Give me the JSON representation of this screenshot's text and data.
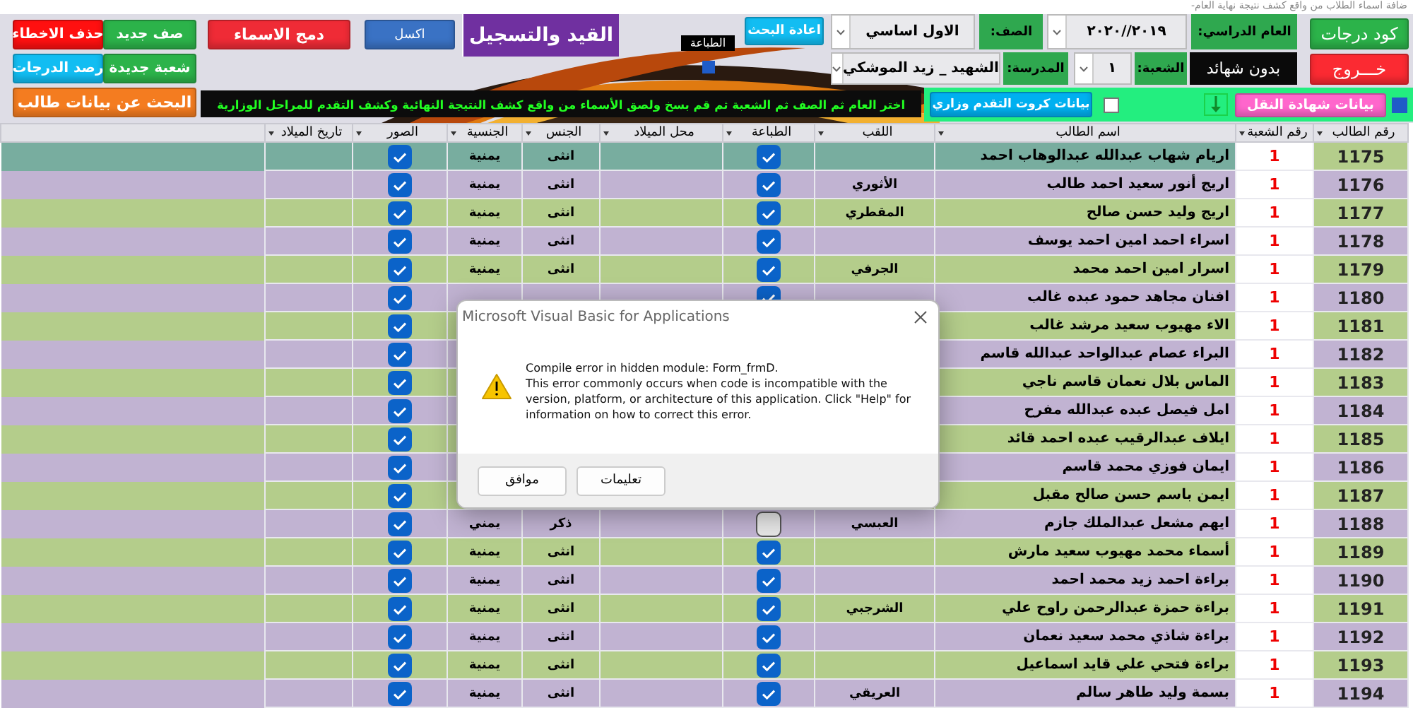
{
  "hint_text": "ضافة اسماء الطلاب من واقع كشف نتيجة نهاية العام-",
  "left_buttons": [
    {
      "label": "صف جديد",
      "color": "#2cb34a"
    },
    {
      "label": "حذف الاخطاء",
      "color": "#ff1010"
    },
    {
      "label": "شعبة جديدة",
      "color": "#2cb34a"
    },
    {
      "label": "رصد الدرجات",
      "color": "#12bdf2"
    },
    {
      "label": "البحث عن بيانات طالب",
      "color": "#f47c20"
    }
  ],
  "toolbar_buttons": [
    {
      "label": "اكسل",
      "color": "#3a72c4"
    },
    {
      "label": "دمج الاسماء",
      "color": "#ef2b36"
    }
  ],
  "title": "القيد والتسجيل",
  "print_toggle": {
    "label": "الطباعة",
    "checked": true
  },
  "reset_button": "اعادة البحث",
  "filters_top": [
    {
      "label": "العام الدراسي:",
      "value": "٢٠١٩//٢٠٢٠"
    },
    {
      "label": "الصف:",
      "value": "الاول اساسي"
    }
  ],
  "no_certificates": "بدون شهائد",
  "filters_bottom": [
    {
      "label": "الشعبة:",
      "value": "١"
    },
    {
      "label": "المدرسة:",
      "value": "الشهيد _ زيد الموشكي"
    }
  ],
  "right_buttons": [
    {
      "label": "كود درجات",
      "color": "#2cb34a"
    },
    {
      "label": "خـــروج",
      "color": "#fb2a32"
    }
  ],
  "notice": "اختر العام ثم الصف ثم الشعبة ثم قم بسخ ولصق الأسماء من واقع كشف النتيجة النهائية وكشف التقدم للمراحل الوزارية",
  "transfer_certificate": {
    "label": "بيانات شهادة النقل",
    "checked": true
  },
  "progress_cards": {
    "label": "بيانات كروت التقدم وزاري",
    "checked": false
  },
  "table": {
    "columns": [
      "رقم الطالب",
      "رقم الشعبة",
      "اسم الطالب",
      "اللقب",
      "الطباعة",
      "محل الميلاد",
      "الجنس",
      "الجنسية",
      "الصور",
      "تاريخ الميلاد"
    ],
    "rows": [
      {
        "id": "1175",
        "section": "1",
        "name": "اريام شهاب عبدالله عبدالوهاب احمد",
        "printing": true,
        "gender": "انثى",
        "nationality": "يمنية",
        "photos": true,
        "selected": true
      },
      {
        "id": "1176",
        "section": "1",
        "name": "اريج أنور سعيد احمد طالب",
        "surname": "الأثوري",
        "printing": true,
        "gender": "انثى",
        "nationality": "يمنية",
        "photos": true,
        "selected": false
      },
      {
        "id": "1177",
        "section": "1",
        "name": "اريج وليد حسن صالح",
        "surname": "المقطري",
        "printing": true,
        "gender": "انثى",
        "nationality": "يمنية",
        "photos": true,
        "selected": false
      },
      {
        "id": "1178",
        "section": "1",
        "name": "اسراء احمد امين احمد يوسف",
        "printing": true,
        "gender": "انثى",
        "nationality": "يمنية",
        "photos": true,
        "selected": false
      },
      {
        "id": "1179",
        "section": "1",
        "name": "اسرار امين احمد محمد",
        "surname": "الجرفي",
        "printing": true,
        "gender": "انثى",
        "nationality": "يمنية",
        "photos": true,
        "selected": false
      },
      {
        "id": "1180",
        "section": "1",
        "name": "افنان مجاهد حمود عبده غالب",
        "printing": true,
        "photos": true,
        "selected": false
      },
      {
        "id": "1181",
        "section": "1",
        "name": "الاء مهيوب سعيد مرشد غالب",
        "photos": true,
        "selected": false
      },
      {
        "id": "1182",
        "section": "1",
        "name": "البراء عصام عبدالواحد عبدالله قاسم",
        "photos": true,
        "selected": false
      },
      {
        "id": "1183",
        "section": "1",
        "name": "الماس بلال نعمان قاسم ناجي",
        "photos": true,
        "selected": false
      },
      {
        "id": "1184",
        "section": "1",
        "name": "امل فيصل عبده عبدالله مفرح",
        "photos": true,
        "selected": false
      },
      {
        "id": "1185",
        "section": "1",
        "name": "ايلاف عبدالرقيب عبده احمد قائد",
        "photos": true,
        "selected": false
      },
      {
        "id": "1186",
        "section": "1",
        "name": "ايمان فوزي محمد قاسم",
        "photos": true,
        "selected": false
      },
      {
        "id": "1187",
        "section": "1",
        "name": "ايمن باسم حسن صالح مقبل",
        "photos": true,
        "selected": false
      },
      {
        "id": "1188",
        "section": "1",
        "name": "ايهم مشعل عبدالملك جازم",
        "surname": "العبسي",
        "printing": false,
        "gender": "ذكر",
        "nationality": "يمني",
        "photos": true,
        "selected": false
      },
      {
        "id": "1189",
        "section": "1",
        "name": "أسماء محمد مهيوب سعيد مارش",
        "printing": true,
        "gender": "انثى",
        "nationality": "يمنية",
        "photos": true,
        "selected": false
      },
      {
        "id": "1190",
        "section": "1",
        "name": "براءة احمد زيد محمد احمد",
        "printing": true,
        "gender": "انثى",
        "nationality": "يمنية",
        "photos": true,
        "selected": false
      },
      {
        "id": "1191",
        "section": "1",
        "name": "براءة حمزة عبدالرحمن راوح علي",
        "surname": "الشرجبي",
        "printing": true,
        "gender": "انثى",
        "nationality": "يمنية",
        "photos": true,
        "selected": false
      },
      {
        "id": "1192",
        "section": "1",
        "name": "براءة شاذي محمد سعيد نعمان",
        "printing": true,
        "gender": "انثى",
        "nationality": "يمنية",
        "photos": true,
        "selected": false
      },
      {
        "id": "1193",
        "section": "1",
        "name": "براءة فتحي علي قايد اسماعيل",
        "printing": true,
        "gender": "انثى",
        "nationality": "يمنية",
        "photos": true,
        "selected": false
      },
      {
        "id": "1194",
        "section": "1",
        "name": "بسمة وليد طاهر سالم",
        "surname": "العريقي",
        "printing": true,
        "gender": "انثى",
        "nationality": "يمنية",
        "photos": true,
        "selected": false
      }
    ]
  },
  "dialog": {
    "title": "Microsoft Visual Basic for Applications",
    "message": [
      "Compile error in hidden module:  Form_frmD.",
      "This error commonly occurs when code is incompatible with the version, platform, or architecture of this application.  Click \"Help\" for information on how to correct this error."
    ],
    "buttons": [
      "تعليمات",
      "موافق"
    ]
  }
}
